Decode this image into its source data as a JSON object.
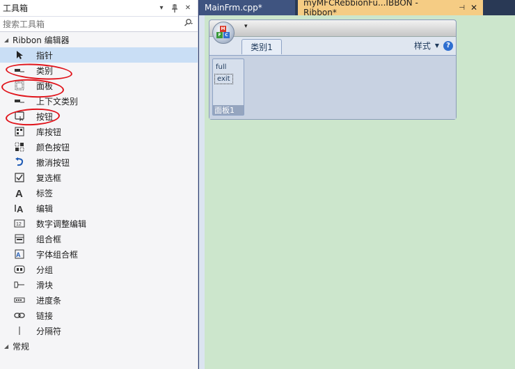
{
  "toolbox": {
    "title": "工具箱",
    "controls": {
      "dropdown": "▾",
      "pin": "⊥",
      "close": "✕"
    },
    "search_placeholder": "搜索工具箱",
    "group_ribbon": "Ribbon 编辑器",
    "items": [
      {
        "label": "指针",
        "icon": "pointer-icon",
        "selected": true
      },
      {
        "label": "类别",
        "icon": "category-icon"
      },
      {
        "label": "面板",
        "icon": "panel-icon"
      },
      {
        "label": "上下文类别",
        "icon": "context-category-icon"
      },
      {
        "label": "按钮",
        "icon": "button-icon"
      },
      {
        "label": "库按钮",
        "icon": "gallery-button-icon"
      },
      {
        "label": "颜色按钮",
        "icon": "color-button-icon"
      },
      {
        "label": "撤消按钮",
        "icon": "undo-button-icon"
      },
      {
        "label": "复选框",
        "icon": "checkbox-icon"
      },
      {
        "label": "标签",
        "icon": "label-icon"
      },
      {
        "label": "编辑",
        "icon": "edit-icon"
      },
      {
        "label": "数字调整编辑",
        "icon": "spin-edit-icon"
      },
      {
        "label": "组合框",
        "icon": "combobox-icon"
      },
      {
        "label": "字体组合框",
        "icon": "font-combobox-icon"
      },
      {
        "label": "分组",
        "icon": "group-icon"
      },
      {
        "label": "滑块",
        "icon": "slider-icon"
      },
      {
        "label": "进度条",
        "icon": "progress-bar-icon"
      },
      {
        "label": "链接",
        "icon": "link-icon"
      },
      {
        "label": "分隔符",
        "icon": "separator-icon"
      }
    ],
    "group_general": "常规"
  },
  "tabs": [
    {
      "label": "MainFrm.cpp*",
      "active": false
    },
    {
      "label": "myMFCRebbionFu...IBBON - Ribbon*",
      "active": true
    }
  ],
  "ribbon": {
    "qat_symbol": "▾",
    "category_tab": "类别1",
    "style_label": "样式",
    "help": "?",
    "panel": {
      "buttons": [
        "full",
        "exit"
      ],
      "caption": "面板1"
    }
  },
  "colors": {
    "accent": "#f5cc84",
    "annotation": "#e0141b",
    "canvas": "#cce6cc"
  }
}
